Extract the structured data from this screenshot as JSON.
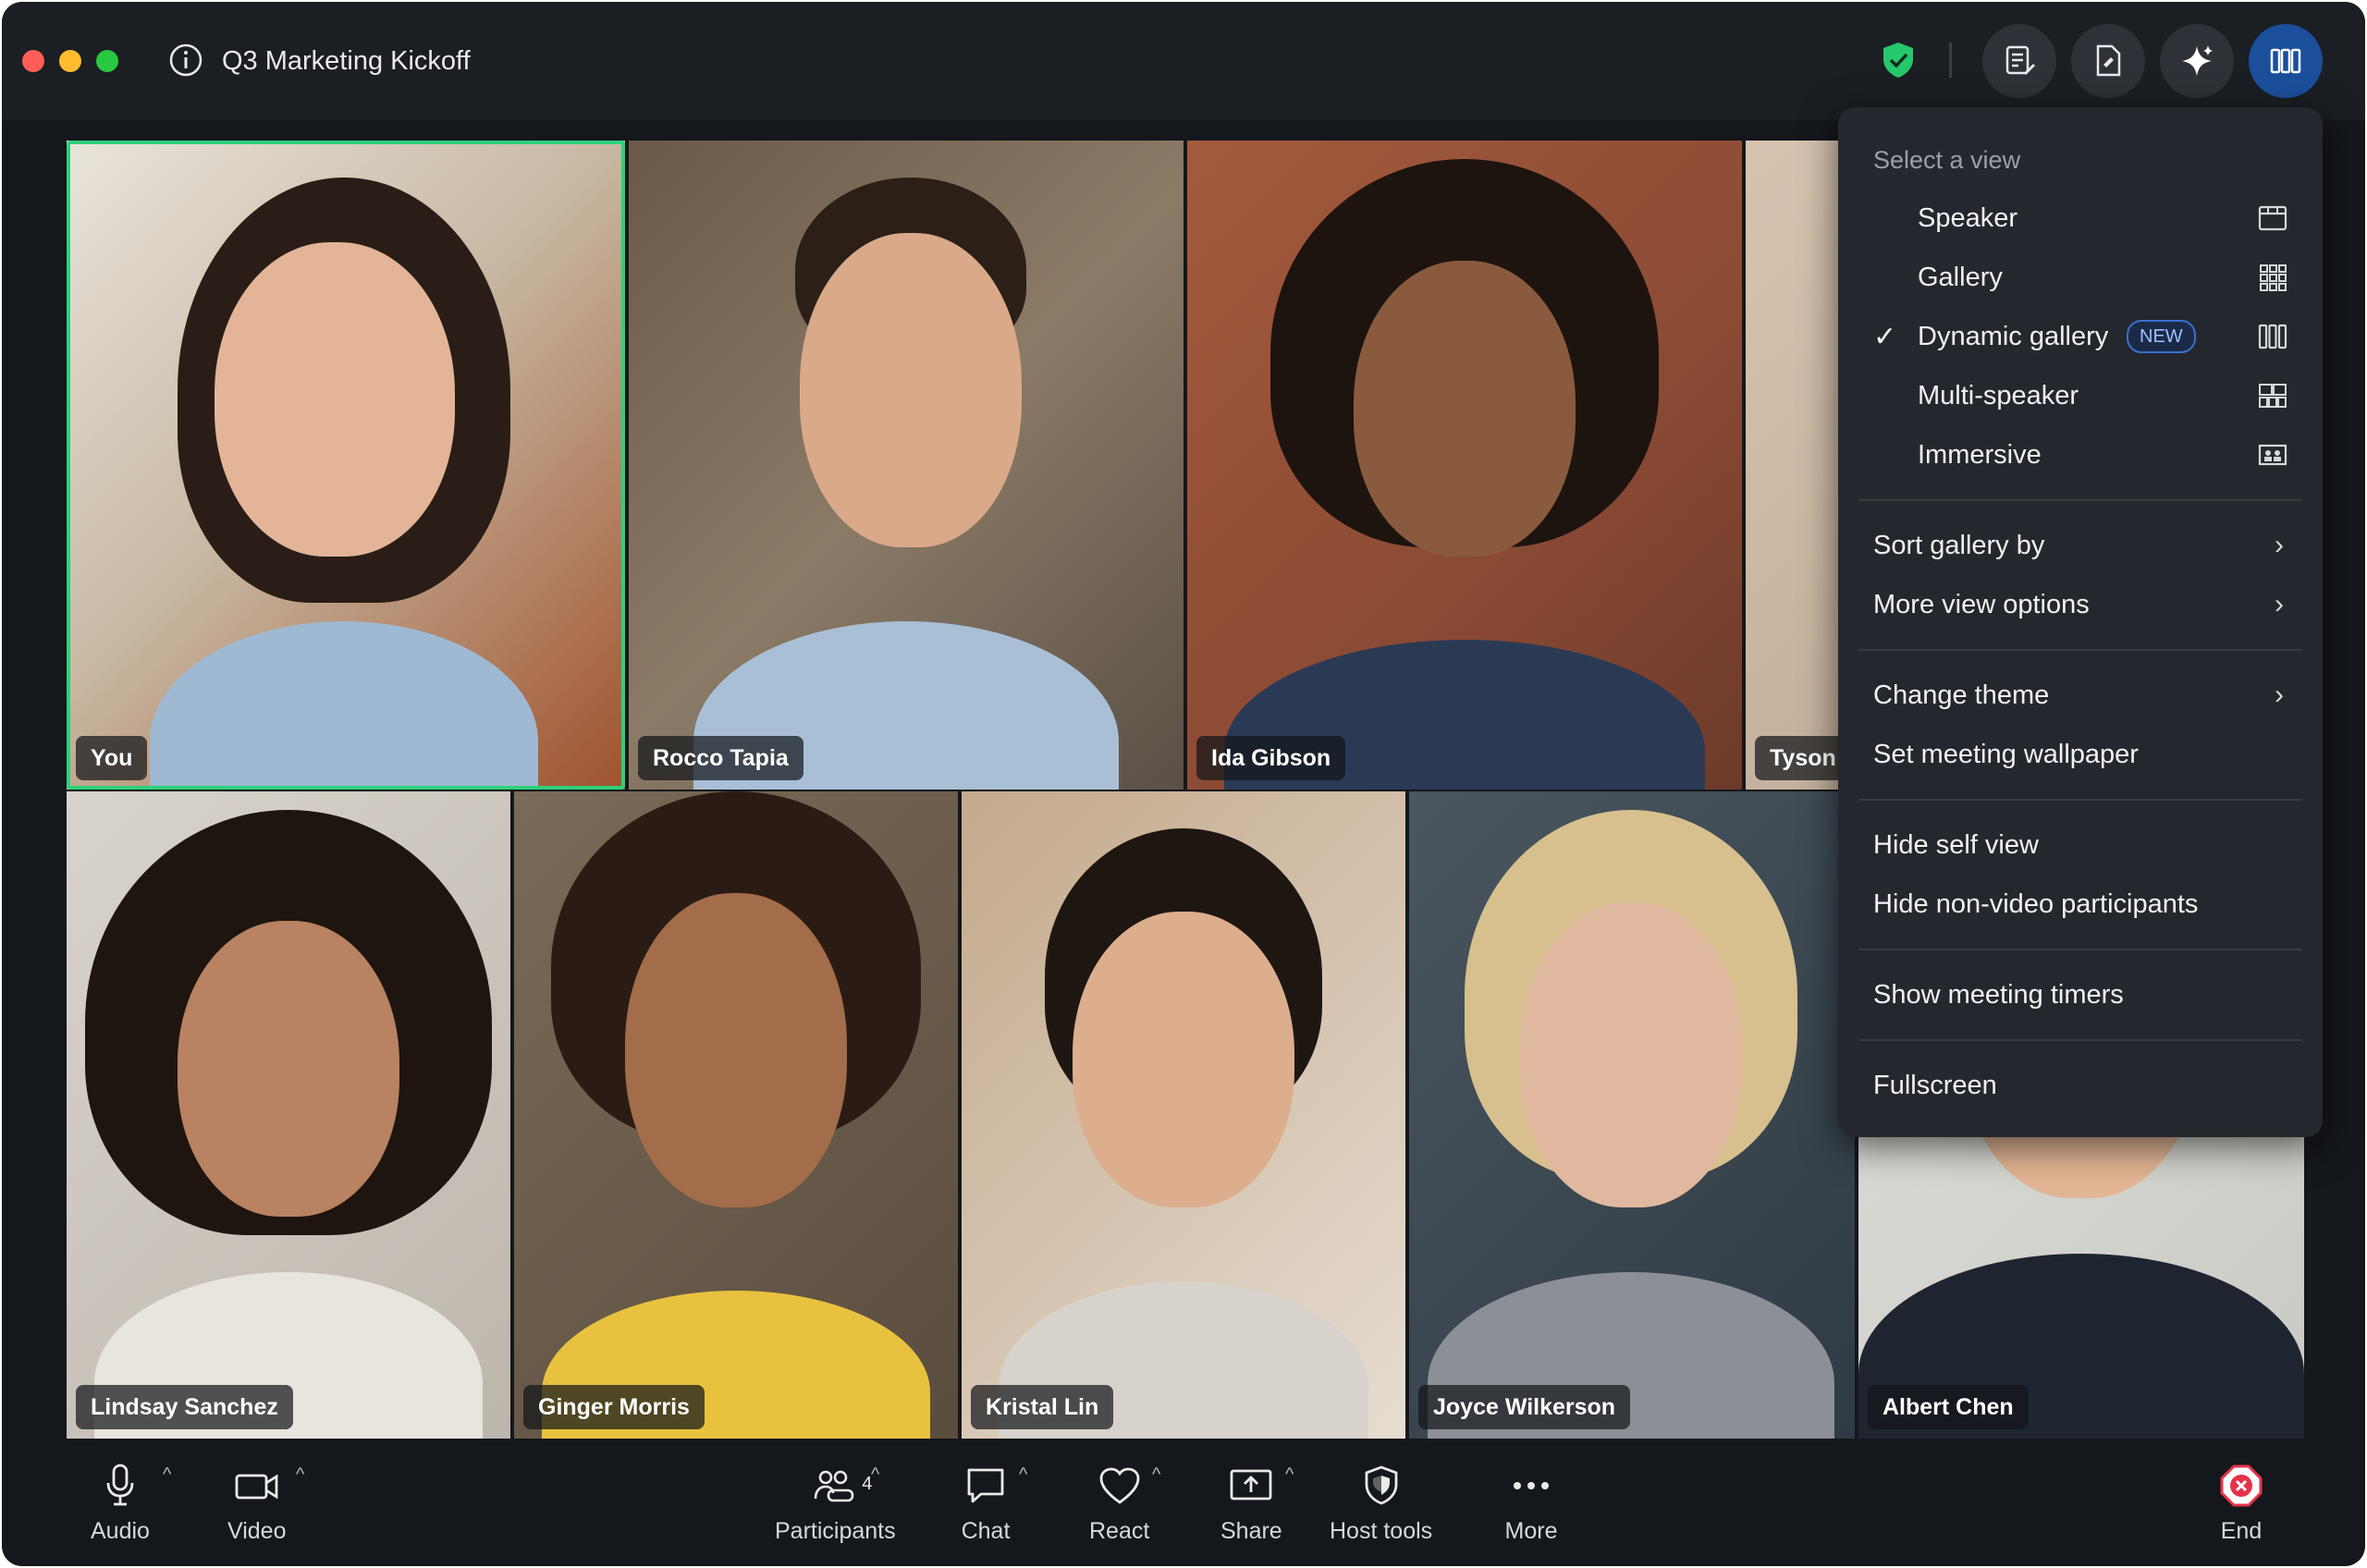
{
  "window": {
    "title": "Q3 Marketing Kickoff"
  },
  "titlebar": {
    "buttons": [
      "notes-icon",
      "whiteboard-icon",
      "ai-assistant-icon",
      "view-layout-icon"
    ],
    "secure_icon": "shield-check-icon"
  },
  "participants": [
    {
      "name": "You",
      "self": true
    },
    {
      "name": "Rocco Tapia"
    },
    {
      "name": "Ida Gibson"
    },
    {
      "name": "Tyson"
    },
    {
      "name": "Lindsay Sanchez"
    },
    {
      "name": "Ginger Morris"
    },
    {
      "name": "Kristal Lin"
    },
    {
      "name": "Joyce Wilkerson"
    },
    {
      "name": "Albert Chen"
    }
  ],
  "view_menu": {
    "header": "Select a view",
    "views": [
      {
        "label": "Speaker",
        "icon": "speaker-view-icon",
        "selected": false
      },
      {
        "label": "Gallery",
        "icon": "gallery-view-icon",
        "selected": false
      },
      {
        "label": "Dynamic gallery",
        "icon": "dynamic-gallery-icon",
        "selected": true,
        "badge": "NEW"
      },
      {
        "label": "Multi-speaker",
        "icon": "multi-speaker-icon",
        "selected": false
      },
      {
        "label": "Immersive",
        "icon": "immersive-view-icon",
        "selected": false
      }
    ],
    "check_mark": "✓",
    "sort_gallery": "Sort gallery by",
    "more_view_options": "More view options",
    "change_theme": "Change theme",
    "set_wallpaper": "Set meeting wallpaper",
    "hide_self_view": "Hide self view",
    "hide_non_video": "Hide non-video participants",
    "show_timers": "Show meeting timers",
    "fullscreen": "Fullscreen",
    "chevron": "›"
  },
  "toolbar": {
    "audio": "Audio",
    "video": "Video",
    "participants": "Participants",
    "participants_count": "4",
    "chat": "Chat",
    "react": "React",
    "share": "Share",
    "host_tools": "Host tools",
    "more": "More",
    "end": "End",
    "caret": "^"
  },
  "colors": {
    "window_bg": "#14171b",
    "accent_blue": "#1b4f9c",
    "self_border": "#2fd07a",
    "end_red": "#e5324b"
  }
}
